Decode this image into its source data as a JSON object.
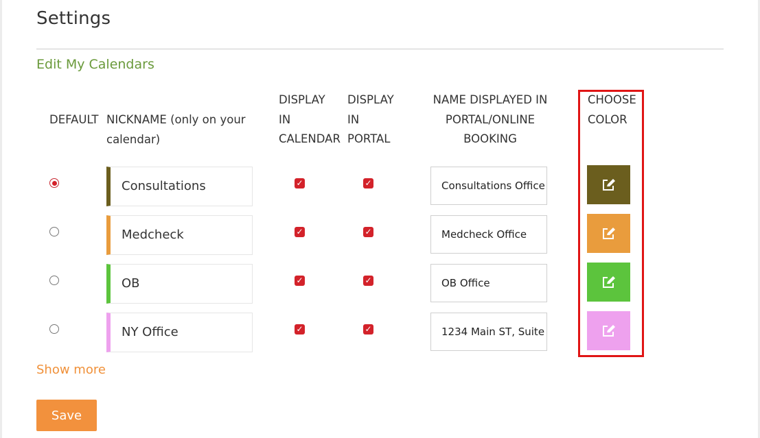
{
  "page": {
    "title": "Settings"
  },
  "section": {
    "title": "Edit My Calendars"
  },
  "columns": {
    "default": "DEFAULT",
    "nickname": [
      "NICKNAME (only on your",
      "calendar)"
    ],
    "display_calendar": [
      "DISPLAY",
      "IN",
      "CALENDAR"
    ],
    "display_portal": [
      "DISPLAY",
      "IN",
      "PORTAL"
    ],
    "portal_name": [
      "NAME DISPLAYED IN",
      "PORTAL/ONLINE",
      "BOOKING"
    ],
    "choose_color": [
      "CHOOSE",
      "COLOR"
    ]
  },
  "calendars": [
    {
      "nickname": "Consultations",
      "portal_name": "Consultations Office",
      "default": true,
      "display_in_calendar": true,
      "display_in_portal": true,
      "color": "#6b5e1e"
    },
    {
      "nickname": "Medcheck",
      "portal_name": "Medcheck Office",
      "default": false,
      "display_in_calendar": true,
      "display_in_portal": true,
      "color": "#e99c3d"
    },
    {
      "nickname": "OB",
      "portal_name": "OB Office",
      "default": false,
      "display_in_calendar": true,
      "display_in_portal": true,
      "color": "#5cc43d"
    },
    {
      "nickname": "NY Office",
      "portal_name": "1234 Main ST, Suite",
      "default": false,
      "display_in_calendar": true,
      "display_in_portal": true,
      "color": "#eea1ee"
    }
  ],
  "icons": {
    "checkbox": "checkmark-icon",
    "color_button": "edit-pencil-icon"
  },
  "show_more": "Show more",
  "save_label": "Save",
  "colors": {
    "accent_green": "#6a9a3b",
    "accent_orange": "#f2913d",
    "checkbox_red": "#d3222a",
    "highlight_red": "#e01515"
  }
}
